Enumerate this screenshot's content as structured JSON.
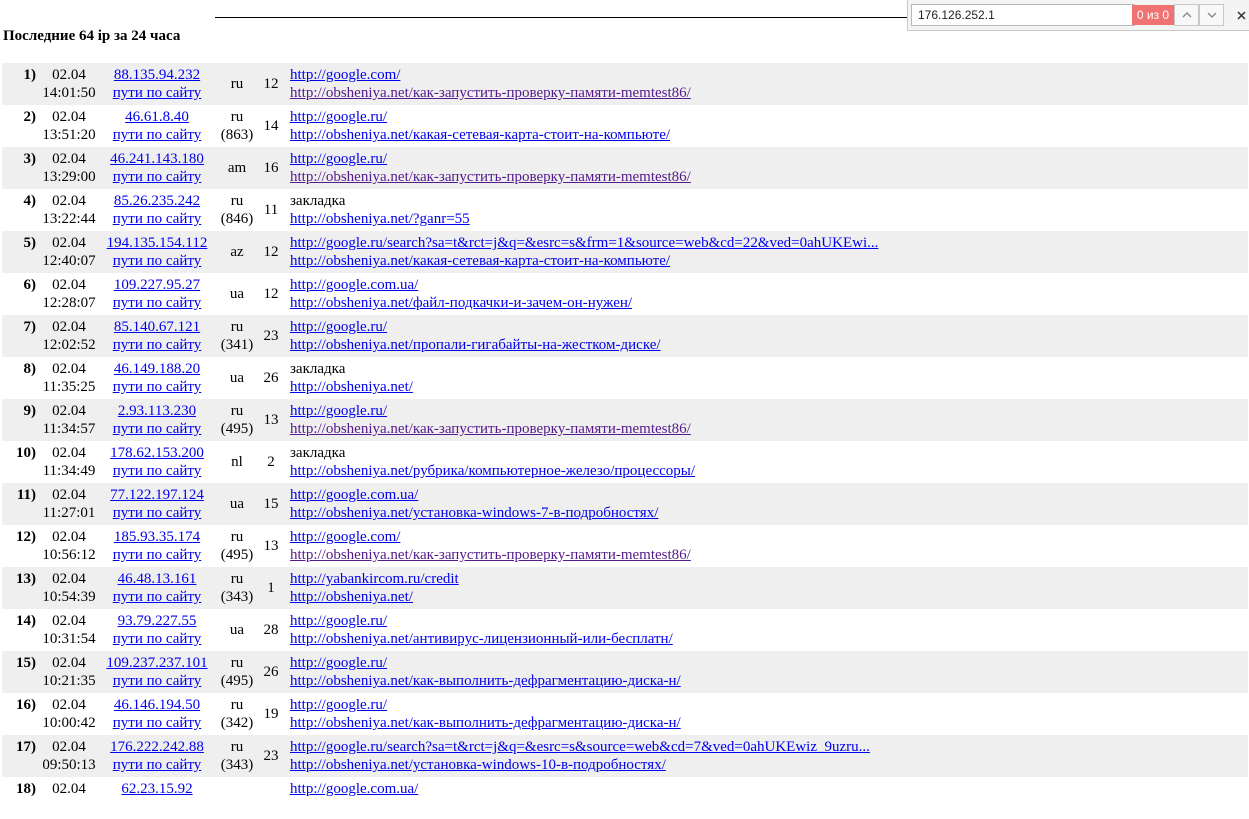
{
  "find_bar": {
    "query": "176.126.252.1",
    "match_count": "0 из 0",
    "prev_icon": "chevron-up",
    "next_icon": "chevron-down",
    "close_icon": "close"
  },
  "page": {
    "title": "Последние 64 ip за 24 часа"
  },
  "colors": {
    "link": "#0000ee",
    "visited": "#551a8b",
    "row_shade": "#efefef",
    "no_match": "#f07373"
  },
  "rows": [
    {
      "num": "1)",
      "date": "02.04",
      "time": "14:01:50",
      "ip": "88.135.94.232",
      "paths": "пути по сайту",
      "country": "ru",
      "count": "",
      "pages": "12",
      "from": "http://google.com/",
      "from_link": true,
      "to": "http://obsheniya.net/как-запустить-проверку-памяти-memtest86/",
      "to_visited": true
    },
    {
      "num": "2)",
      "date": "02.04",
      "time": "13:51:20",
      "ip": "46.61.8.40",
      "paths": "пути по сайту",
      "country": "ru",
      "count": "(863)",
      "pages": "14",
      "from": "http://google.ru/",
      "from_link": true,
      "to": "http://obsheniya.net/какая-сетевая-карта-стоит-на-компьюте/",
      "to_visited": false
    },
    {
      "num": "3)",
      "date": "02.04",
      "time": "13:29:00",
      "ip": "46.241.143.180",
      "paths": "пути по сайту",
      "country": "am",
      "count": "",
      "pages": "16",
      "from": "http://google.ru/",
      "from_link": true,
      "to": "http://obsheniya.net/как-запустить-проверку-памяти-memtest86/",
      "to_visited": true
    },
    {
      "num": "4)",
      "date": "02.04",
      "time": "13:22:44",
      "ip": "85.26.235.242",
      "paths": "пути по сайту",
      "country": "ru",
      "count": "(846)",
      "pages": "11",
      "from": "закладка",
      "from_link": false,
      "to": "http://obsheniya.net/?ganr=55",
      "to_visited": false
    },
    {
      "num": "5)",
      "date": "02.04",
      "time": "12:40:07",
      "ip": "194.135.154.112",
      "paths": "пути по сайту",
      "country": "az",
      "count": "",
      "pages": "12",
      "from": "http://google.ru/search?sa=t&rct=j&q=&esrc=s&frm=1&source=web&cd=22&ved=0ahUKEwi...",
      "from_link": true,
      "to": "http://obsheniya.net/какая-сетевая-карта-стоит-на-компьюте/",
      "to_visited": false
    },
    {
      "num": "6)",
      "date": "02.04",
      "time": "12:28:07",
      "ip": "109.227.95.27",
      "paths": "пути по сайту",
      "country": "ua",
      "count": "",
      "pages": "12",
      "from": "http://google.com.ua/",
      "from_link": true,
      "to": "http://obsheniya.net/файл-подкачки-и-зачем-он-нужен/",
      "to_visited": false
    },
    {
      "num": "7)",
      "date": "02.04",
      "time": "12:02:52",
      "ip": "85.140.67.121",
      "paths": "пути по сайту",
      "country": "ru",
      "count": "(341)",
      "pages": "23",
      "from": "http://google.ru/",
      "from_link": true,
      "to": "http://obsheniya.net/пропали-гигабайты-на-жестком-диске/",
      "to_visited": false
    },
    {
      "num": "8)",
      "date": "02.04",
      "time": "11:35:25",
      "ip": "46.149.188.20",
      "paths": "пути по сайту",
      "country": "ua",
      "count": "",
      "pages": "26",
      "from": "закладка",
      "from_link": false,
      "to": "http://obsheniya.net/",
      "to_visited": false
    },
    {
      "num": "9)",
      "date": "02.04",
      "time": "11:34:57",
      "ip": "2.93.113.230",
      "paths": "пути по сайту",
      "country": "ru",
      "count": "(495)",
      "pages": "13",
      "from": "http://google.ru/",
      "from_link": true,
      "to": "http://obsheniya.net/как-запустить-проверку-памяти-memtest86/",
      "to_visited": true
    },
    {
      "num": "10)",
      "date": "02.04",
      "time": "11:34:49",
      "ip": "178.62.153.200",
      "paths": "пути по сайту",
      "country": "nl",
      "count": "",
      "pages": "2",
      "from": "закладка",
      "from_link": false,
      "to": "http://obsheniya.net/рубрика/компьютерное-железо/процессоры/",
      "to_visited": false
    },
    {
      "num": "11)",
      "date": "02.04",
      "time": "11:27:01",
      "ip": "77.122.197.124",
      "paths": "пути по сайту",
      "country": "ua",
      "count": "",
      "pages": "15",
      "from": "http://google.com.ua/",
      "from_link": true,
      "to": "http://obsheniya.net/установка-windows-7-в-подробностях/",
      "to_visited": false
    },
    {
      "num": "12)",
      "date": "02.04",
      "time": "10:56:12",
      "ip": "185.93.35.174",
      "paths": "пути по сайту",
      "country": "ru",
      "count": "(495)",
      "pages": "13",
      "from": "http://google.com/",
      "from_link": true,
      "to": "http://obsheniya.net/как-запустить-проверку-памяти-memtest86/",
      "to_visited": true
    },
    {
      "num": "13)",
      "date": "02.04",
      "time": "10:54:39",
      "ip": "46.48.13.161",
      "paths": "пути по сайту",
      "country": "ru",
      "count": "(343)",
      "pages": "1",
      "from": "http://yabankircom.ru/credit",
      "from_link": true,
      "to": "http://obsheniya.net/",
      "to_visited": false
    },
    {
      "num": "14)",
      "date": "02.04",
      "time": "10:31:54",
      "ip": "93.79.227.55",
      "paths": "пути по сайту",
      "country": "ua",
      "count": "",
      "pages": "28",
      "from": "http://google.ru/",
      "from_link": true,
      "to": "http://obsheniya.net/антивирус-лицензионный-или-бесплатн/",
      "to_visited": false
    },
    {
      "num": "15)",
      "date": "02.04",
      "time": "10:21:35",
      "ip": "109.237.237.101",
      "paths": "пути по сайту",
      "country": "ru",
      "count": "(495)",
      "pages": "26",
      "from": "http://google.ru/",
      "from_link": true,
      "to": "http://obsheniya.net/как-выполнить-дефрагментацию-диска-н/",
      "to_visited": false
    },
    {
      "num": "16)",
      "date": "02.04",
      "time": "10:00:42",
      "ip": "46.146.194.50",
      "paths": "пути по сайту",
      "country": "ru",
      "count": "(342)",
      "pages": "19",
      "from": "http://google.ru/",
      "from_link": true,
      "to": "http://obsheniya.net/как-выполнить-дефрагментацию-диска-н/",
      "to_visited": false
    },
    {
      "num": "17)",
      "date": "02.04",
      "time": "09:50:13",
      "ip": "176.222.242.88",
      "paths": "пути по сайту",
      "country": "ru",
      "count": "(343)",
      "pages": "23",
      "from": "http://google.ru/search?sa=t&rct=j&q=&esrc=s&source=web&cd=7&ved=0ahUKEwiz_9uzru...",
      "from_link": true,
      "to": "http://obsheniya.net/установка-windows-10-в-подробностях/",
      "to_visited": false
    },
    {
      "num": "18)",
      "date": "02.04",
      "time": "",
      "ip": "62.23.15.92",
      "paths": "",
      "country": "",
      "count": "",
      "pages": "",
      "from": "http://google.com.ua/",
      "from_link": true,
      "to": "",
      "to_visited": false
    }
  ]
}
